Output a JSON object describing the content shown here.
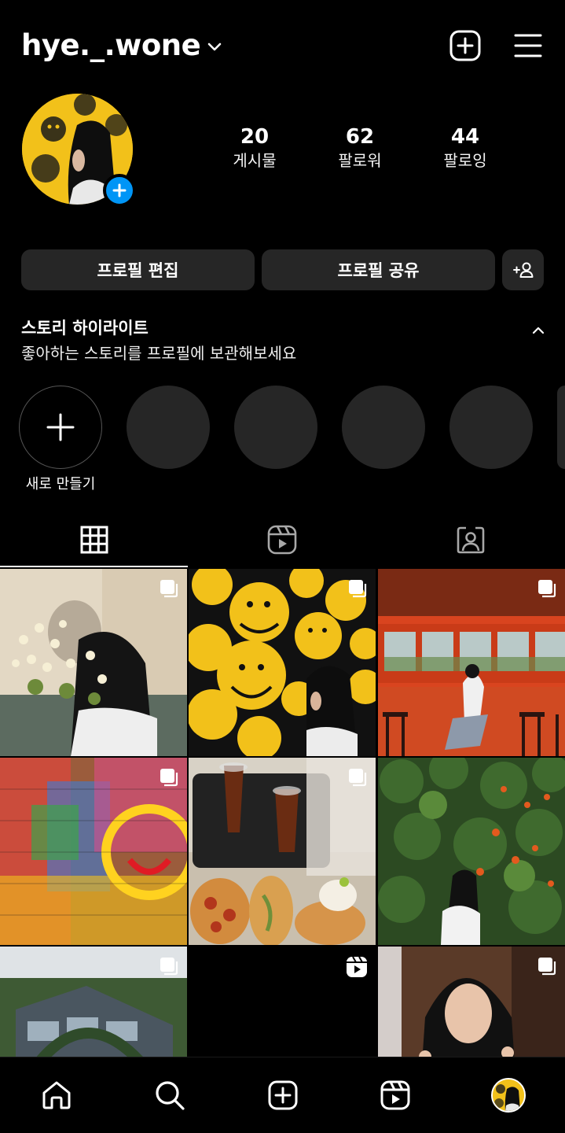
{
  "header": {
    "username": "hye._.wone",
    "icons": [
      "chevron-down-icon",
      "plus-square-icon",
      "menu-icon"
    ]
  },
  "profile": {
    "stats": [
      {
        "value": "20",
        "label": "게시물"
      },
      {
        "value": "62",
        "label": "팔로워"
      },
      {
        "value": "44",
        "label": "팔로잉"
      }
    ],
    "buttons": {
      "edit": "프로필 편집",
      "share": "프로필 공유"
    }
  },
  "highlights": {
    "title": "스토리 하이라이트",
    "subtitle": "좋아하는 스토리를 프로필에 보관해보세요",
    "new_label": "새로 만들기"
  },
  "tabs": [
    "grid-icon",
    "reels-icon",
    "tagged-icon"
  ],
  "posts": [
    {
      "theme": "flowers",
      "badge": "multi-photo-icon"
    },
    {
      "theme": "smileys",
      "badge": "multi-photo-icon"
    },
    {
      "theme": "red-cafe",
      "badge": "multi-photo-icon"
    },
    {
      "theme": "graffiti",
      "badge": "multi-photo-icon"
    },
    {
      "theme": "bakery",
      "badge": "multi-photo-icon"
    },
    {
      "theme": "flower-vine",
      "badge": "none"
    },
    {
      "theme": "building",
      "badge": "multi-photo-icon"
    },
    {
      "theme": "dark-reel",
      "badge": "reel-icon"
    },
    {
      "theme": "portrait",
      "badge": "multi-photo-icon"
    }
  ],
  "bottom_nav": [
    "home-icon",
    "search-icon",
    "create-icon",
    "reels-icon",
    "profile-avatar"
  ],
  "colors": {
    "background": "#000000",
    "button": "#262626",
    "accent_blue": "#0095f6",
    "smiley_yellow": "#f2c11a"
  }
}
